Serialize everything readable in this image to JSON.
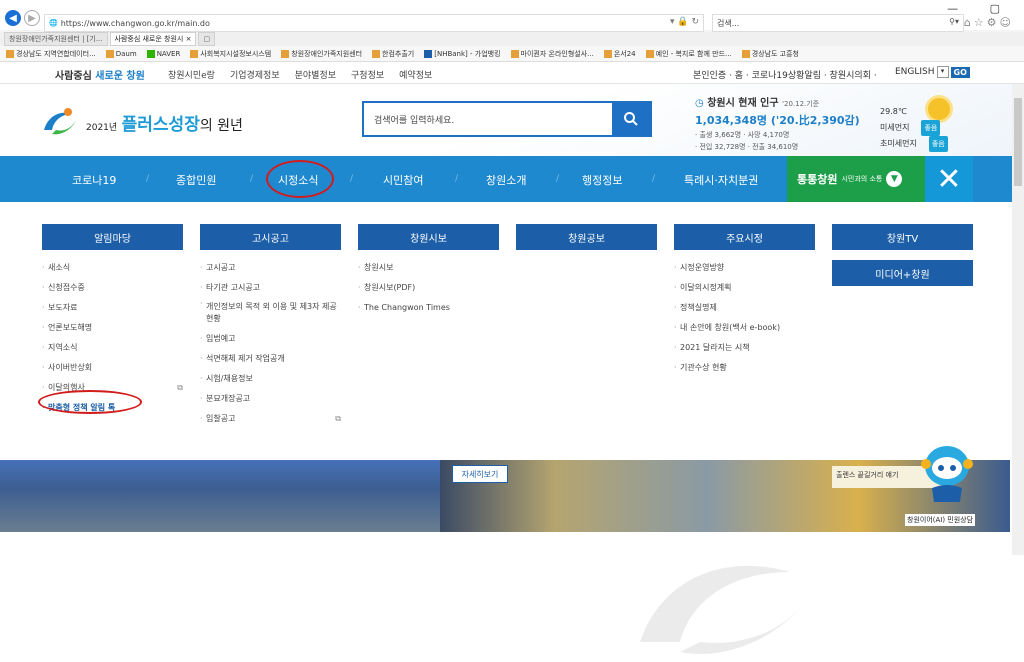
{
  "browser": {
    "url": "https://www.changwon.go.kr/main.do",
    "search_placeholder": "검색...",
    "tabs": [
      "창원장애인가족지원센터 | [기...",
      "사람중심 새로운 창원시"
    ],
    "favorites": [
      "경상남도 지역연합데이터...",
      "Daum",
      "NAVER",
      "사회복지시설정보시스템",
      "창원장애인가족지원센터",
      "한컴추출기",
      "[NHBank] - 가업뱅킹",
      "마이퀀자 온라인형설사...",
      "온서24",
      "예인 - 복지로 함께 만드...",
      "경상남도 고흥청"
    ]
  },
  "topbar": {
    "brand_a": "사람중심",
    "brand_b": "새로운 창원",
    "nav": [
      "창원시민e랑",
      "기업경제정보",
      "분야별정보",
      "구청정보",
      "예약정보"
    ],
    "links": "본인인증 · 홈 · 코로나19상황알림 · 창원시의회 ·",
    "lang": "ENGLISH",
    "go": "GO"
  },
  "header": {
    "logo_year": "2021년",
    "logo_main": "플러스성장",
    "logo_tail": "의 원년",
    "search_placeholder": "검색어를 입력하세요.",
    "population_title": "창원시 현재 인구",
    "population_date": "'20.12.기준",
    "population_value": "1,034,348명 ('20.比2,390감)",
    "population_row1": "· 출생 3,662명   · 사망 4,170명",
    "population_row2": "· 전입 32,728명   · 전출 34,610명",
    "temperature": "29.8℃",
    "dust_label": "미세먼지",
    "dust_value": "좋음",
    "ultra_dust_label": "초미세먼지",
    "ultra_dust_value": "좋음"
  },
  "gnb": {
    "items": [
      "코로나19",
      "종합민원",
      "시정소식",
      "시민참여",
      "창원소개",
      "행정정보",
      "특례시·자치분권"
    ],
    "sotong": "통통창원",
    "sotong_sub": "시민과의 소통"
  },
  "mega": {
    "columns": [
      {
        "title": "알림마당",
        "items": [
          "새소식",
          "신청접수중",
          "보도자료",
          "언론보도해명",
          "지역소식",
          "사이버반상회",
          "이달의행사",
          "맞춤형 정책 알림 톡"
        ]
      },
      {
        "title": "고시공고",
        "items": [
          "고시공고",
          "타기관 고시공고",
          "개인정보의 목적 외 이용 및 제3자 제공 현황",
          "입법예고",
          "석면해체 제거 작업공개",
          "시험/채용정보",
          "분묘개장공고",
          "입찰공고"
        ]
      },
      {
        "title": "창원시보",
        "items": [
          "창원시보",
          "창원시보(PDF)",
          "The Changwon Times"
        ]
      },
      {
        "title": "창원공보",
        "items": []
      },
      {
        "title": "주요시정",
        "items": [
          "시정운영방향",
          "이달의시정계획",
          "정책실명제",
          "내 손안에 창원(백서 e-book)",
          "2021 달라지는 시책",
          "기관수상 현황"
        ]
      },
      {
        "title": "창원TV",
        "items": [],
        "sub_button": "미디어+창원"
      }
    ]
  },
  "banner": {
    "more_button": "자세히보기",
    "card_text": "출렌스 끝길거리 얘기",
    "chatbot_label": "창원이어(AI) 민원상담"
  }
}
